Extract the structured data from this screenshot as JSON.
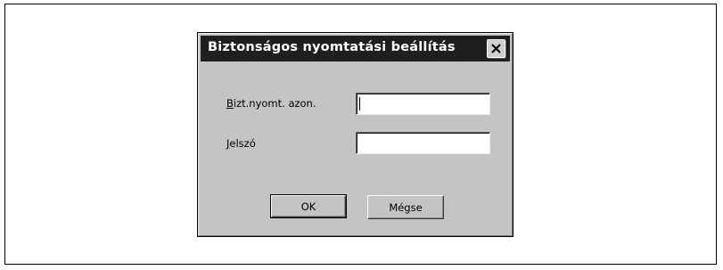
{
  "dialog": {
    "title": "Biztonságos nyomtatási beállítás",
    "close_icon": "close-icon"
  },
  "fields": {
    "secure_id": {
      "label_prefix": "B",
      "label_rest": "izt.nyomt. azon.",
      "value": ""
    },
    "password": {
      "label_prefix": "J",
      "label_rest": "elszó",
      "value": ""
    }
  },
  "buttons": {
    "ok_label": "OK",
    "cancel_label": "Mégse"
  }
}
